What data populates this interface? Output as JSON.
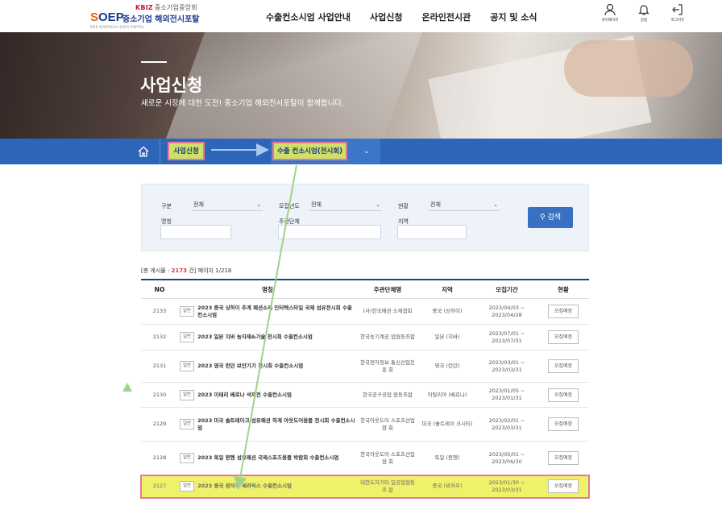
{
  "header": {
    "logo_kbiz": "KBIZ",
    "logo_kbiz_sub": "중소기업중앙회",
    "logo_soep": "SOEP",
    "logo_portal": "중소기업 해외전시포탈",
    "logo_sub": "SME OVERSEAS EXPO PORTAL",
    "nav": [
      "수출컨소시엄 사업안내",
      "사업신청",
      "온라인전시관",
      "공지 및 소식"
    ],
    "utils": [
      {
        "icon": "person-icon",
        "label": "마이페이지"
      },
      {
        "icon": "bell-icon",
        "label": "알림"
      },
      {
        "icon": "logout-icon",
        "label": "로그아웃"
      }
    ]
  },
  "hero": {
    "title": "사업신청",
    "subtitle": "새로운 시장에 대한 도전! 중소기업 해외전시포탈이 함께합니다."
  },
  "location": {
    "home_icon": "home-icon",
    "item1": "사업신청",
    "item2": "수출 컨소시엄(전시회)"
  },
  "search": {
    "label_type": "구분",
    "type_value": "전체",
    "label_year": "모집년도",
    "year_value": "전체",
    "label_status": "현황",
    "status_value": "전체",
    "label_name": "명칭",
    "label_org": "주관단체",
    "label_region": "지역",
    "button": "검색"
  },
  "count": {
    "prefix": "[총 게시물 : ",
    "total": "2173",
    "suffix": " 건] 페이지 1/218"
  },
  "table": {
    "headers": [
      "NO",
      "명칭",
      "주관단체명",
      "지역",
      "모집기간",
      "현황"
    ],
    "rows": [
      {
        "no": "2133",
        "badge": "일반",
        "title": "2023 중국 상하이 추계 패션소재 인터텍스타일 국제 섬유전시회 수출컨소시엄",
        "org": "(사)한국패션 소재협회",
        "region": "중국 (상하이)",
        "period": "2023/04/03 ~ 2023/04/28",
        "status": "모집예정"
      },
      {
        "no": "2132",
        "badge": "일반",
        "title": "2023 일본 지바 농자재&기술 전시회 수출컨소시엄",
        "org": "한국농기계공 업협동조합",
        "region": "일본 (지바)",
        "period": "2023/07/01 ~ 2023/07/31",
        "status": "모집예정"
      },
      {
        "no": "2131",
        "badge": "일반",
        "title": "2023 영국 런던 보안기기 전시회 수출컨소시엄",
        "org": "한국전자정보 통신산업진흥 회",
        "region": "영국 (런던)",
        "period": "2023/03/01 ~ 2023/03/31",
        "status": "모집예정"
      },
      {
        "no": "2130",
        "badge": "일반",
        "title": "2023 이태리 베로나 석재전 수출컨소시엄",
        "org": "한국공구공업 협동조합",
        "region": "이탈리아 (베로나)",
        "period": "2023/01/05 ~ 2023/01/31",
        "status": "모집예정"
      },
      {
        "no": "2129",
        "badge": "일반",
        "title": "2023 미국 솔트레이크 섬유패션 하계 아웃도어용품 전시회 수출컨소시엄",
        "org": "한국아웃도어 스포츠산업협 회",
        "region": "미국 (솔트레이 크시티)",
        "period": "2023/02/01 ~ 2023/03/31",
        "status": "모집예정"
      },
      {
        "no": "2128",
        "badge": "일반",
        "title": "2023 독일 뮌헨 섬유패션 국제스포츠용품 박람회 수출컨소시엄",
        "org": "한국아웃도어 스포츠산업협 회",
        "region": "독일 (뮌헨)",
        "period": "2023/05/01 ~ 2023/06/30",
        "status": "모집예정"
      },
      {
        "no": "2127",
        "badge": "일반",
        "title": "2023 중국 광저우 세라믹스 수출컨소시엄",
        "org": "대한도자기타 일공업협동조 합",
        "region": "중국 (광저우)",
        "period": "2023/01/30 ~ 2023/03/31",
        "status": "모집예정"
      }
    ]
  }
}
